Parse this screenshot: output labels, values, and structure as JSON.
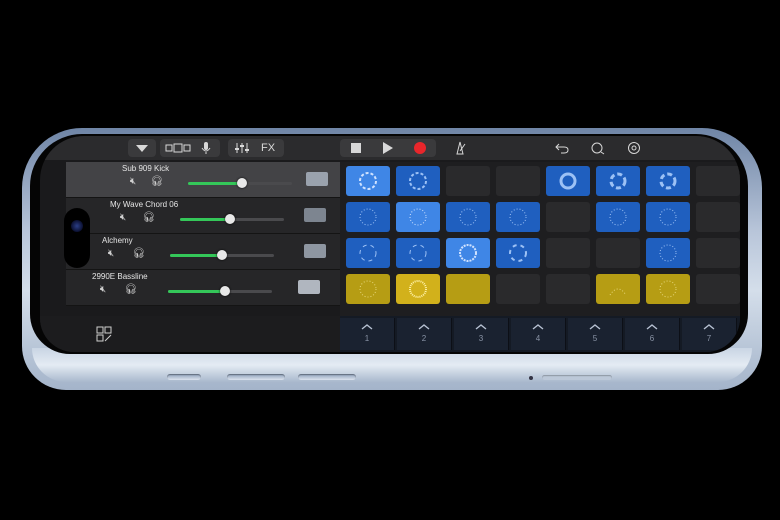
{
  "toolbar": {
    "fx_label": "FX",
    "record_color": "#e8262b"
  },
  "tracks": [
    {
      "name": "Sub 909 Kick",
      "volume": 0.52,
      "instrument_icon": "drum-machine-icon"
    },
    {
      "name": "My Wave Chord 06",
      "volume": 0.48,
      "instrument_icon": "synth-icon"
    },
    {
      "name": "Alchemy",
      "volume": 0.5,
      "instrument_icon": "keyboard-icon"
    },
    {
      "name": "2990E Bassline",
      "volume": 0.55,
      "instrument_icon": "bass-synth-icon"
    }
  ],
  "triggers": [
    "1",
    "2",
    "3",
    "4",
    "5",
    "6",
    "7"
  ],
  "colors": {
    "accent_green": "#34c759",
    "cell_blue": "#1f5fbf",
    "cell_yellow": "#b69d14"
  }
}
